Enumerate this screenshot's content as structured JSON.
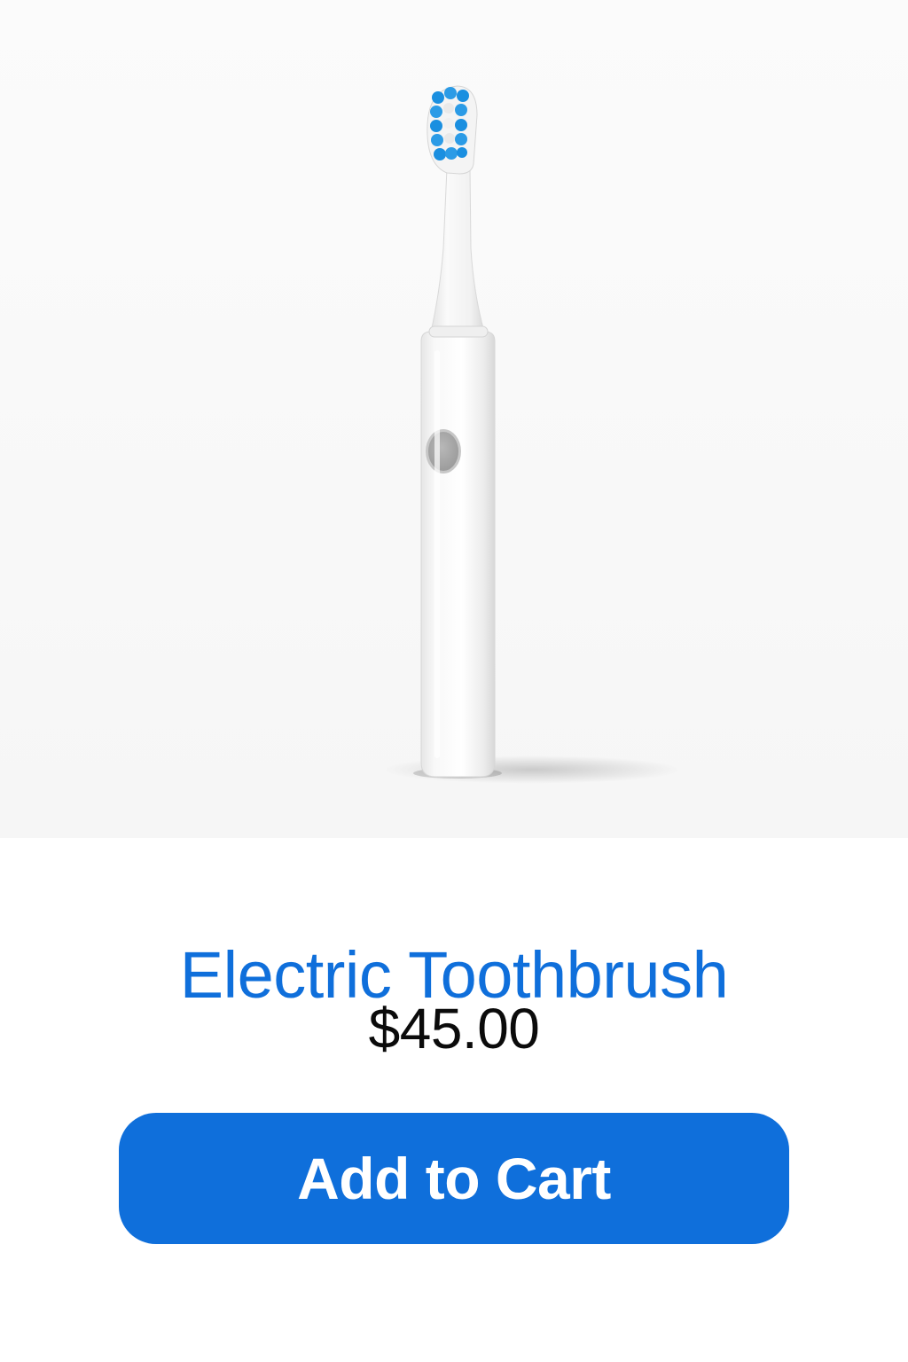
{
  "product": {
    "image_alt": "",
    "title": "Electric Toothbrush",
    "price": "$45.00",
    "add_to_cart_label": "Add to Cart"
  },
  "colors": {
    "accent": "#0f6fdb",
    "background": "#ffffff",
    "price_text": "#0b0b0b"
  }
}
